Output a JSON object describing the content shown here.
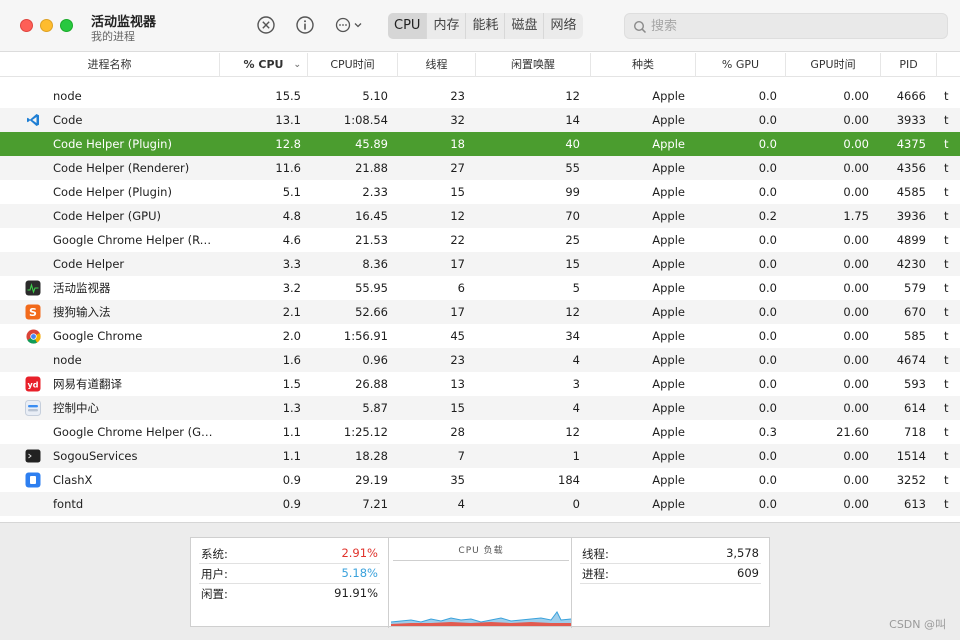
{
  "window": {
    "title": "活动监视器",
    "subtitle": "我的进程"
  },
  "toolbar": {
    "tabs": [
      {
        "label": "CPU",
        "active": true
      },
      {
        "label": "内存",
        "active": false
      },
      {
        "label": "能耗",
        "active": false
      },
      {
        "label": "磁盘",
        "active": false
      },
      {
        "label": "网络",
        "active": false
      }
    ],
    "search_placeholder": "搜索",
    "icons": [
      "stop-process-icon",
      "info-icon",
      "more-options-icon",
      "chevron-down-icon",
      "search-icon"
    ]
  },
  "columns": [
    "进程名称",
    "% CPU",
    "CPU时间",
    "线程",
    "闲置唤醒",
    "种类",
    "% GPU",
    "GPU时间",
    "PID"
  ],
  "sort_column": "% CPU",
  "processes": [
    {
      "icon": "",
      "name": "node",
      "cpu": "15.5",
      "time": "5.10",
      "threads": "23",
      "wake": "12",
      "kind": "Apple",
      "gpu": "0.0",
      "gputime": "0.00",
      "pid": "4666",
      "user": "t"
    },
    {
      "icon": "vscode-icon",
      "name": "Code",
      "cpu": "13.1",
      "time": "1:08.54",
      "threads": "32",
      "wake": "14",
      "kind": "Apple",
      "gpu": "0.0",
      "gputime": "0.00",
      "pid": "3933",
      "user": "t"
    },
    {
      "icon": "",
      "name": "Code Helper (Plugin)",
      "cpu": "12.8",
      "time": "45.89",
      "threads": "18",
      "wake": "40",
      "kind": "Apple",
      "gpu": "0.0",
      "gputime": "0.00",
      "pid": "4375",
      "user": "t",
      "selected": true
    },
    {
      "icon": "",
      "name": "Code Helper (Renderer)",
      "cpu": "11.6",
      "time": "21.88",
      "threads": "27",
      "wake": "55",
      "kind": "Apple",
      "gpu": "0.0",
      "gputime": "0.00",
      "pid": "4356",
      "user": "t"
    },
    {
      "icon": "",
      "name": "Code Helper (Plugin)",
      "cpu": "5.1",
      "time": "2.33",
      "threads": "15",
      "wake": "99",
      "kind": "Apple",
      "gpu": "0.0",
      "gputime": "0.00",
      "pid": "4585",
      "user": "t"
    },
    {
      "icon": "",
      "name": "Code Helper (GPU)",
      "cpu": "4.8",
      "time": "16.45",
      "threads": "12",
      "wake": "70",
      "kind": "Apple",
      "gpu": "0.2",
      "gputime": "1.75",
      "pid": "3936",
      "user": "t"
    },
    {
      "icon": "",
      "name": "Google Chrome Helper (Re...",
      "cpu": "4.6",
      "time": "21.53",
      "threads": "22",
      "wake": "25",
      "kind": "Apple",
      "gpu": "0.0",
      "gputime": "0.00",
      "pid": "4899",
      "user": "t"
    },
    {
      "icon": "",
      "name": "Code Helper",
      "cpu": "3.3",
      "time": "8.36",
      "threads": "17",
      "wake": "15",
      "kind": "Apple",
      "gpu": "0.0",
      "gputime": "0.00",
      "pid": "4230",
      "user": "t"
    },
    {
      "icon": "activity-monitor-icon",
      "name": "活动监视器",
      "cpu": "3.2",
      "time": "55.95",
      "threads": "6",
      "wake": "5",
      "kind": "Apple",
      "gpu": "0.0",
      "gputime": "0.00",
      "pid": "579",
      "user": "t"
    },
    {
      "icon": "sogou-input-icon",
      "name": "搜狗输入法",
      "cpu": "2.1",
      "time": "52.66",
      "threads": "17",
      "wake": "12",
      "kind": "Apple",
      "gpu": "0.0",
      "gputime": "0.00",
      "pid": "670",
      "user": "t"
    },
    {
      "icon": "chrome-icon",
      "name": "Google Chrome",
      "cpu": "2.0",
      "time": "1:56.91",
      "threads": "45",
      "wake": "34",
      "kind": "Apple",
      "gpu": "0.0",
      "gputime": "0.00",
      "pid": "585",
      "user": "t"
    },
    {
      "icon": "",
      "name": "node",
      "cpu": "1.6",
      "time": "0.96",
      "threads": "23",
      "wake": "4",
      "kind": "Apple",
      "gpu": "0.0",
      "gputime": "0.00",
      "pid": "4674",
      "user": "t"
    },
    {
      "icon": "youdao-icon",
      "name": "网易有道翻译",
      "cpu": "1.5",
      "time": "26.88",
      "threads": "13",
      "wake": "3",
      "kind": "Apple",
      "gpu": "0.0",
      "gputime": "0.00",
      "pid": "593",
      "user": "t"
    },
    {
      "icon": "control-center-icon",
      "name": "控制中心",
      "cpu": "1.3",
      "time": "5.87",
      "threads": "15",
      "wake": "4",
      "kind": "Apple",
      "gpu": "0.0",
      "gputime": "0.00",
      "pid": "614",
      "user": "t"
    },
    {
      "icon": "",
      "name": "Google Chrome Helper (GPU)",
      "cpu": "1.1",
      "time": "1:25.12",
      "threads": "28",
      "wake": "12",
      "kind": "Apple",
      "gpu": "0.3",
      "gputime": "21.60",
      "pid": "718",
      "user": "t"
    },
    {
      "icon": "terminal-icon",
      "name": "SogouServices",
      "cpu": "1.1",
      "time": "18.28",
      "threads": "7",
      "wake": "1",
      "kind": "Apple",
      "gpu": "0.0",
      "gputime": "0.00",
      "pid": "1514",
      "user": "t"
    },
    {
      "icon": "clashx-icon",
      "name": "ClashX",
      "cpu": "0.9",
      "time": "29.19",
      "threads": "35",
      "wake": "184",
      "kind": "Apple",
      "gpu": "0.0",
      "gputime": "0.00",
      "pid": "3252",
      "user": "t"
    },
    {
      "icon": "",
      "name": "fontd",
      "cpu": "0.9",
      "time": "7.21",
      "threads": "4",
      "wake": "0",
      "kind": "Apple",
      "gpu": "0.0",
      "gputime": "0.00",
      "pid": "613",
      "user": "t"
    }
  ],
  "summary": {
    "system_label": "系统:",
    "system_value": "2.91%",
    "user_label": "用户:",
    "user_value": "5.18%",
    "idle_label": "闲置:",
    "idle_value": "91.91%",
    "graph_title": "CPU 负载",
    "threads_label": "线程:",
    "threads_value": "3,578",
    "processes_label": "进程:",
    "processes_value": "609"
  },
  "colors": {
    "selected_row": "#4b9d2f",
    "system_red": "#e0322b",
    "user_blue": "#3aa2dc"
  },
  "watermark": "CSDN @叫"
}
